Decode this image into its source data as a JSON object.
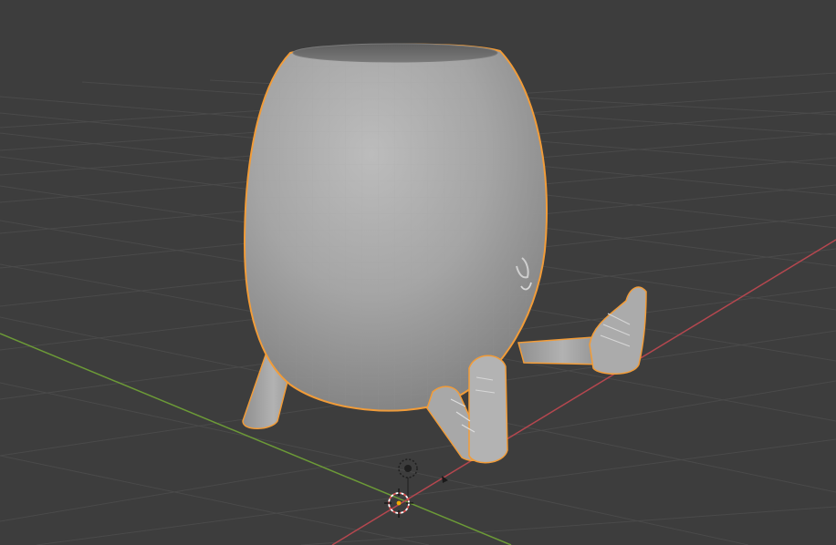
{
  "viewport": {
    "background": "#3d3d3d",
    "grid_color": "#4a4a4a",
    "x_axis_color": "#b5474f",
    "y_axis_color": "#6c9a37",
    "selection_outline_color": "#f29c38",
    "mesh_color": "#a8a8a8"
  },
  "scene": {
    "selected_object": "pot-with-legs",
    "origin_marker": "3d-cursor-icon",
    "light_marker": "light-icon",
    "camera_marker": "camera-direction-icon"
  }
}
